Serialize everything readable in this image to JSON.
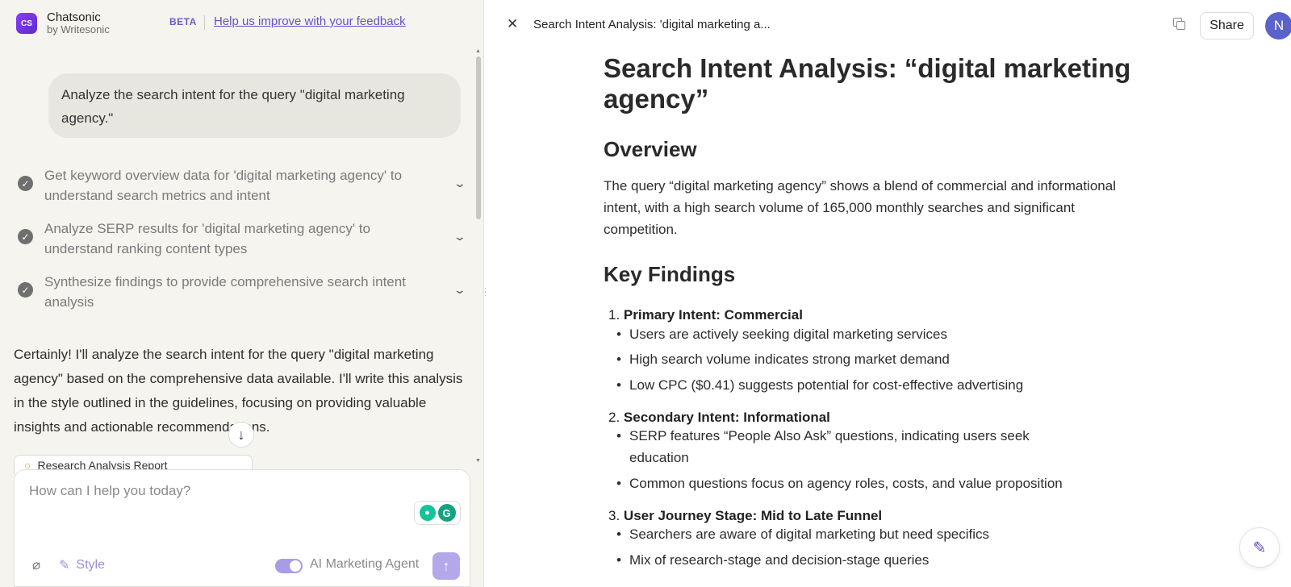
{
  "brand": {
    "logo_text": "CS",
    "name": "Chatsonic",
    "sub": "by Writesonic",
    "beta": "BETA",
    "feedback_link": "Help us improve with your feedback"
  },
  "chat": {
    "user_message": "Analyze the search intent for the query \"digital marketing agency.\"",
    "steps": [
      {
        "label": "Get keyword overview data for 'digital marketing agency' to understand search metrics and intent"
      },
      {
        "label": "Analyze SERP results for 'digital marketing agency' to understand ranking content types"
      },
      {
        "label": "Synthesize findings to provide comprehensive search intent analysis"
      }
    ],
    "assistant_message": "Certainly! I'll analyze the search intent for the query \"digital marketing agency\" based on the comprehensive data available. I'll write this analysis in the style outlined in the guidelines, focusing on providing valuable insights and actionable recommendations.",
    "report_card_label": "Research Analysis Report"
  },
  "composer": {
    "placeholder": "How can I help you today?",
    "style_label": "Style",
    "agent_label": "AI Marketing Agent",
    "agent_enabled": true
  },
  "doc_header": {
    "title": "Search Intent Analysis: 'digital marketing a...",
    "share_label": "Share",
    "avatar_initial": "N"
  },
  "document": {
    "h1": "Search Intent Analysis: “digital marketing agency”",
    "overview_heading": "Overview",
    "overview_text": "The query “digital marketing agency” shows a blend of commercial and informational intent, with a high search volume of 165,000 monthly searches and significant competition.",
    "key_findings_heading": "Key Findings",
    "findings": [
      {
        "num": "1.",
        "title": "Primary Intent: Commercial",
        "bullets": [
          "Users are actively seeking digital marketing services",
          "High search volume indicates strong market demand",
          "Low CPC ($0.41) suggests potential for cost-effective advertising"
        ]
      },
      {
        "num": "2.",
        "title": "Secondary Intent: Informational",
        "bullets": [
          "SERP features “People Also Ask” questions, indicating users seek education",
          "Common questions focus on agency roles, costs, and value proposition"
        ]
      },
      {
        "num": "3.",
        "title": "User Journey Stage: Mid to Late Funnel",
        "bullets": [
          "Searchers are aware of digital marketing but need specifics",
          "Mix of research-stage and decision-stage queries"
        ]
      }
    ]
  },
  "colors": {
    "accent": "#6750c8",
    "left_bg": "#f5f4ef",
    "user_bubble": "#e8e7df"
  }
}
